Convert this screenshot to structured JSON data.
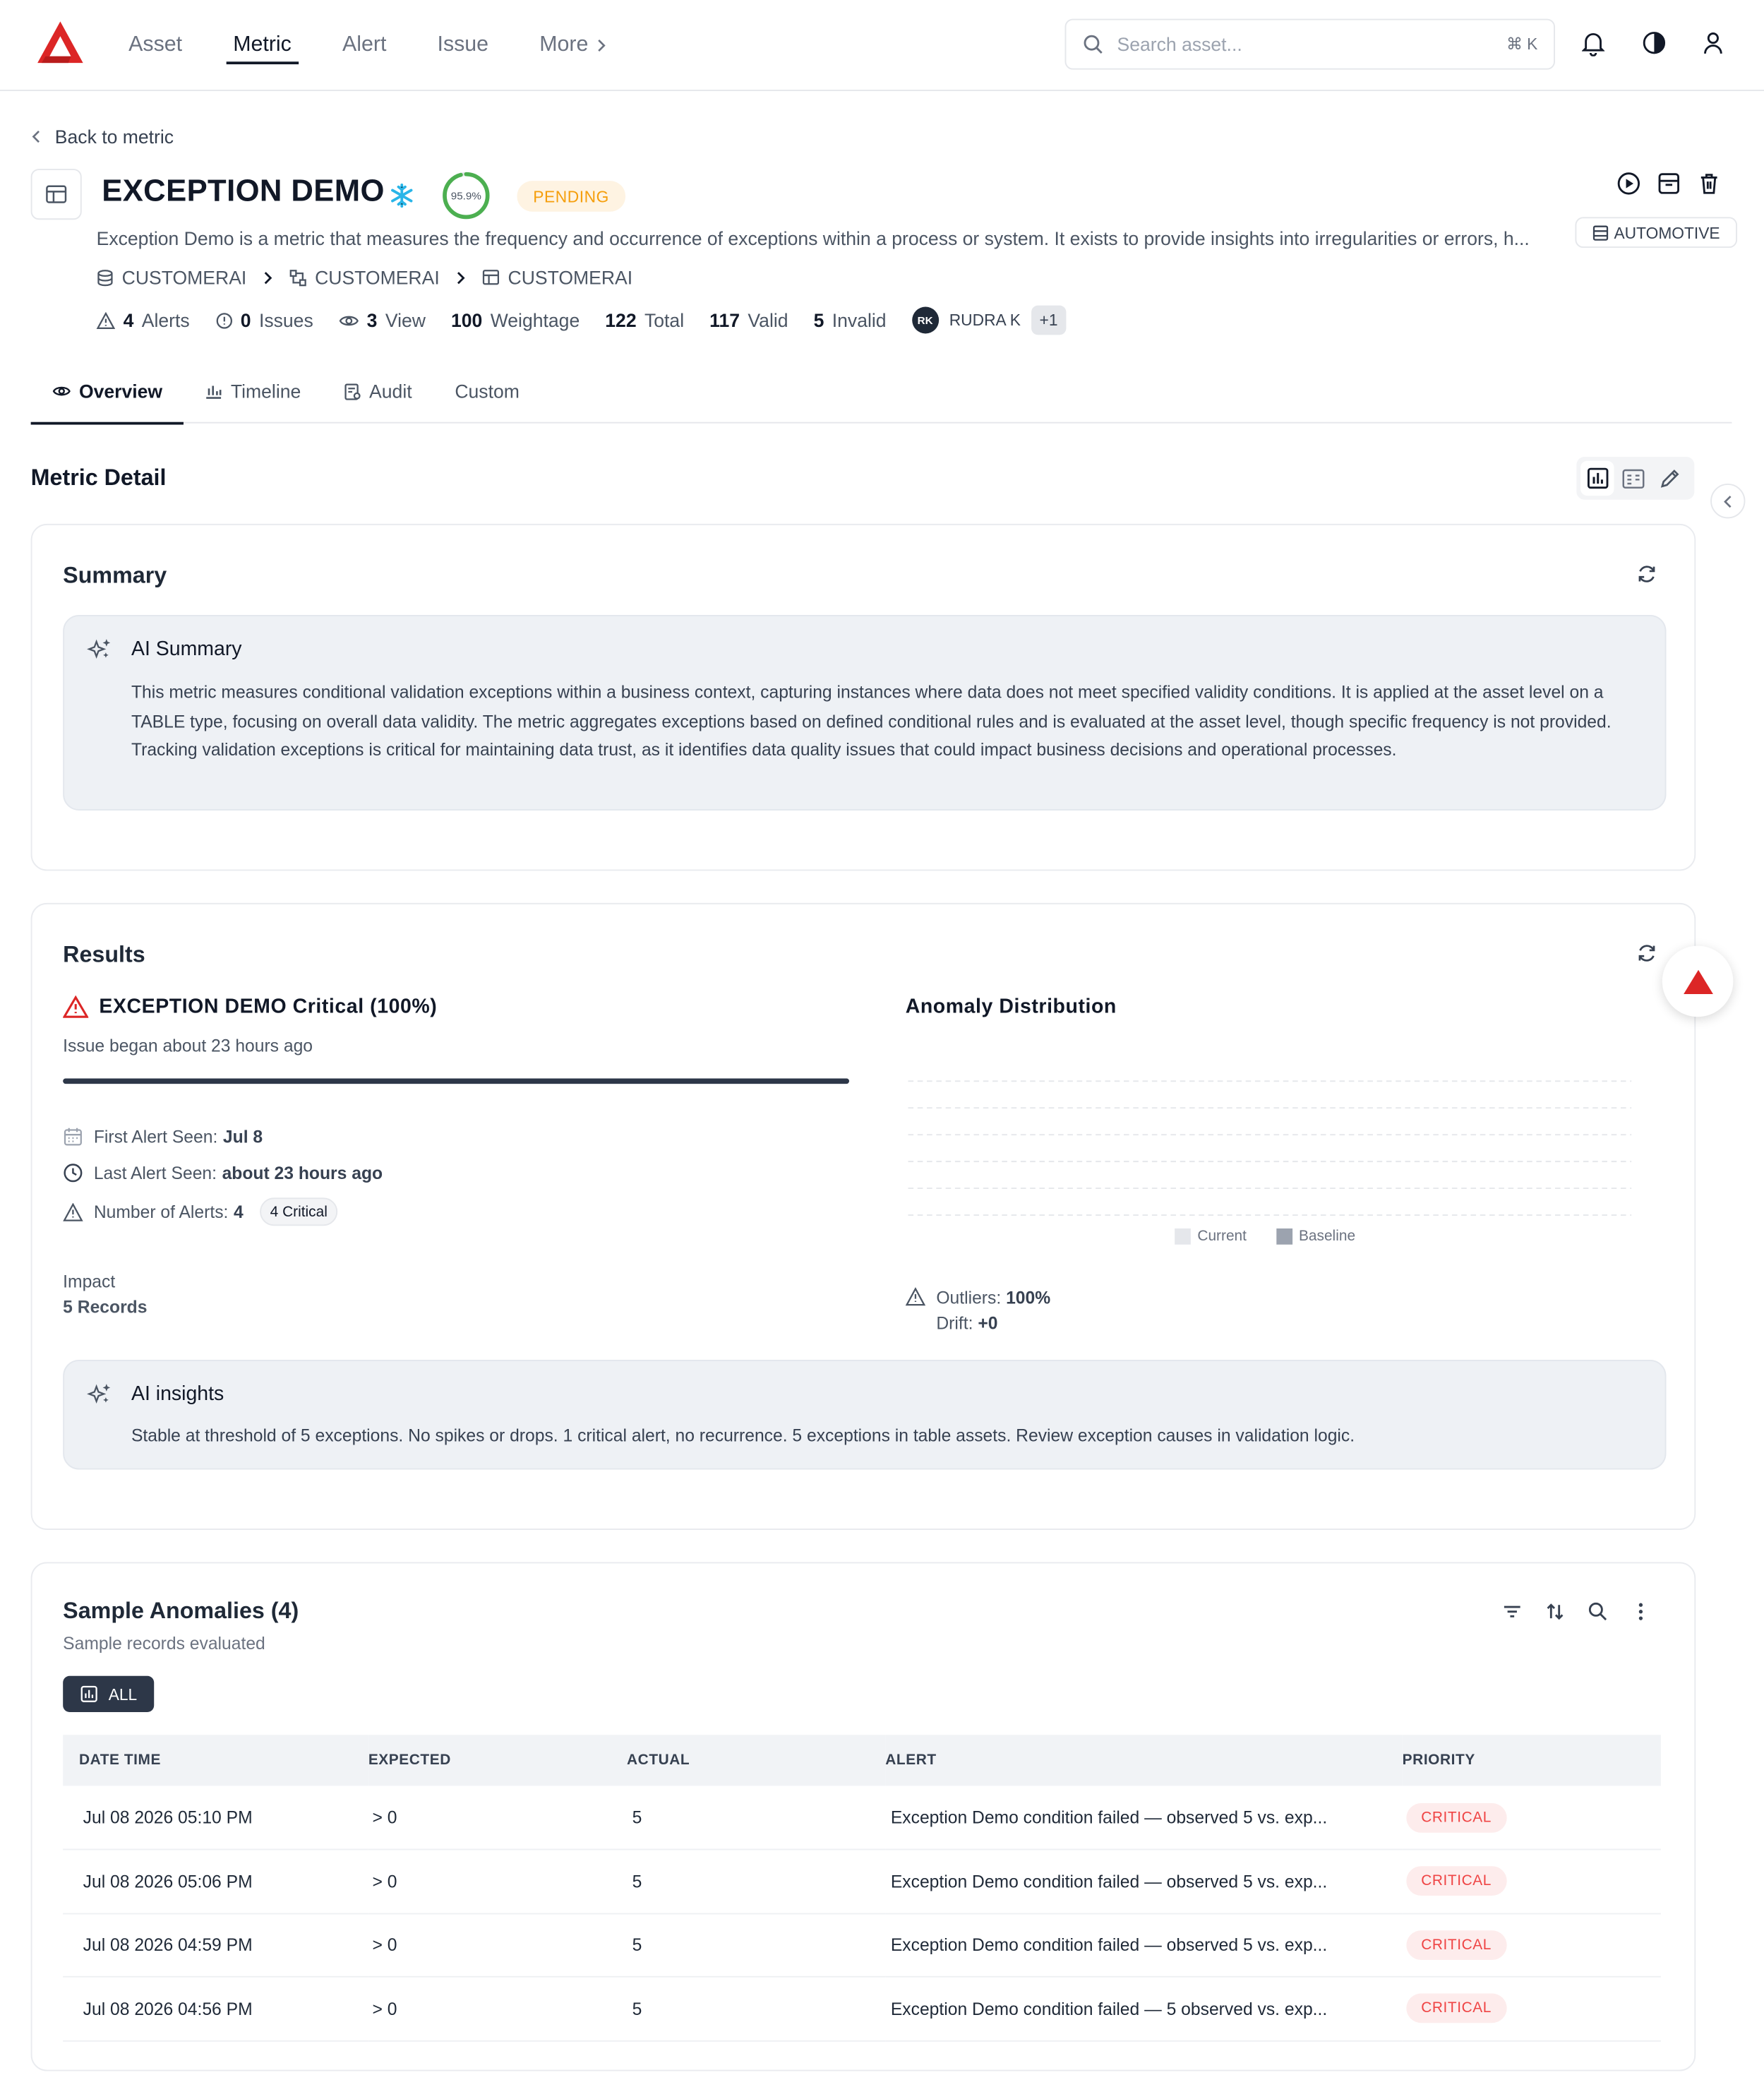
{
  "nav": {
    "items": [
      "Asset",
      "Metric",
      "Alert",
      "Issue"
    ],
    "more_label": "More",
    "active": "Metric",
    "search_placeholder": "Search asset...",
    "search_shortcut": "⌘ K"
  },
  "back_label": "Back to metric",
  "metric": {
    "title": "EXCEPTION DEMO",
    "score": "95.9%",
    "score_value": 95.9,
    "status": "PENDING",
    "domain_tag": "AUTOMOTIVE",
    "description": "Exception Demo is a metric that measures the frequency and occurrence of exceptions within a process or system. It exists to provide insights into irregularities or errors, h...",
    "breadcrumb": [
      "CUSTOMERAI",
      "CUSTOMERAI",
      "CUSTOMERAI"
    ],
    "stats": {
      "alerts_count": "4",
      "alerts_label": "Alerts",
      "issues_count": "0",
      "issues_label": "Issues",
      "views_count": "3",
      "views_label": "View",
      "weightage_count": "100",
      "weightage_label": "Weightage",
      "total_count": "122",
      "total_label": "Total",
      "valid_count": "117",
      "valid_label": "Valid",
      "invalid_count": "5",
      "invalid_label": "Invalid"
    },
    "owner_initials": "RK",
    "owner_name": "RUDRA K",
    "owner_extra": "+1"
  },
  "tabs": [
    "Overview",
    "Timeline",
    "Audit",
    "Custom"
  ],
  "active_tab": "Overview",
  "section_title": "Metric Detail",
  "summary": {
    "title": "Summary",
    "ai_title": "AI Summary",
    "ai_text": "This metric measures conditional validation exceptions within a business context, capturing instances where data does not meet specified validity conditions. It is applied at the asset level on a TABLE type, focusing on overall data validity. The metric aggregates exceptions based on defined conditional rules and is evaluated at the asset level, though specific frequency is not provided. Tracking validation exceptions is critical for maintaining data trust, as it identifies data quality issues that could impact business decisions and operational processes."
  },
  "results": {
    "title": "Results",
    "severity_title": "EXCEPTION DEMO Critical (100%)",
    "severity_percent": 100,
    "began": "Issue began about 23 hours ago",
    "first_seen_label": "First Alert Seen:",
    "first_seen_value": "Jul 8",
    "last_seen_label": "Last Alert Seen:",
    "last_seen_value": "about 23 hours ago",
    "num_alerts_label": "Number of Alerts:",
    "num_alerts_value": "4",
    "critical_chip": "4 Critical",
    "impact_label": "Impact",
    "impact_value": "5 Records",
    "anomaly_title": "Anomaly Distribution",
    "legend_current": "Current",
    "legend_baseline": "Baseline",
    "outliers_label": "Outliers:",
    "outliers_value": "100%",
    "drift_label": "Drift:",
    "drift_value": "+0",
    "ai_title": "AI insights",
    "ai_text": "Stable at threshold of 5 exceptions. No spikes or drops. 1 critical alert, no recurrence. 5 exceptions in table assets. Review exception causes in validation logic."
  },
  "colors": {
    "brand": "#dc2626",
    "score_ring": "#4caf50",
    "pending": "#f59e0b",
    "critical": "#ef4444",
    "legend_current": "#e5e7eb",
    "legend_baseline": "#9ca3af"
  },
  "anomalies": {
    "title": "Sample Anomalies (4)",
    "subtitle": "Sample records evaluated",
    "filter_all": "ALL",
    "columns": [
      "DATE TIME",
      "EXPECTED",
      "ACTUAL",
      "ALERT",
      "PRIORITY"
    ],
    "rows": [
      {
        "datetime": "Jul 08 2026 05:10 PM",
        "expected": "> 0",
        "actual": "5",
        "alert": "Exception Demo condition failed — observed 5 vs. exp...",
        "priority": "CRITICAL"
      },
      {
        "datetime": "Jul 08 2026 05:06 PM",
        "expected": "> 0",
        "actual": "5",
        "alert": "Exception Demo condition failed — observed 5 vs. exp...",
        "priority": "CRITICAL"
      },
      {
        "datetime": "Jul 08 2026 04:59 PM",
        "expected": "> 0",
        "actual": "5",
        "alert": "Exception Demo condition failed — observed 5 vs. exp...",
        "priority": "CRITICAL"
      },
      {
        "datetime": "Jul 08 2026 04:56 PM",
        "expected": "> 0",
        "actual": "5",
        "alert": "Exception Demo condition failed — 5 observed vs. exp...",
        "priority": "CRITICAL"
      }
    ]
  }
}
